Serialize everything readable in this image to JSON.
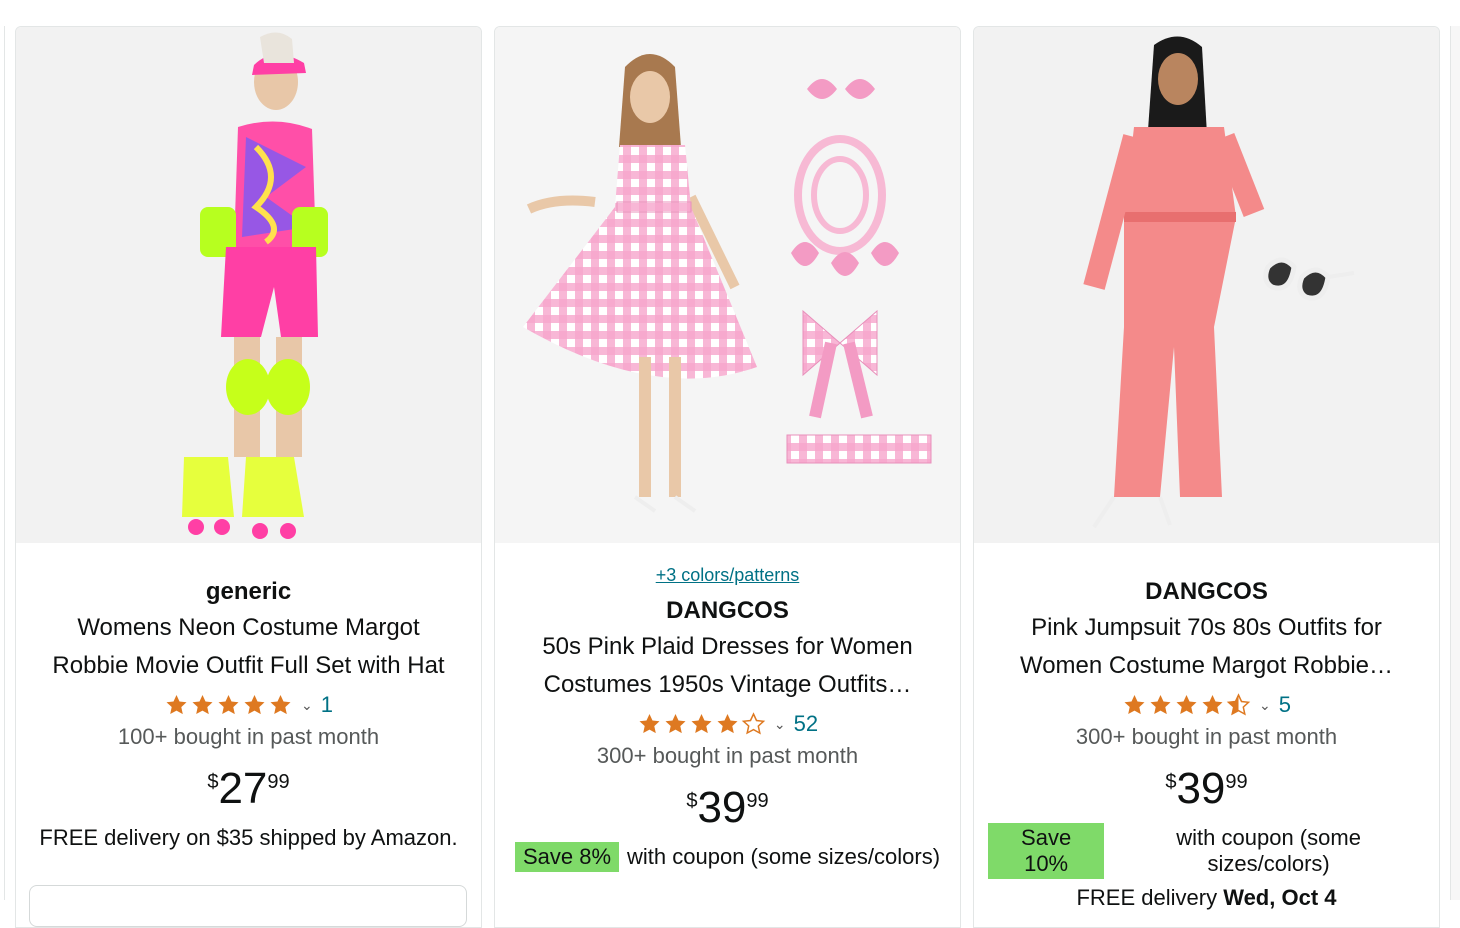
{
  "products": [
    {
      "brand": "generic",
      "title_line1": "Womens Neon Costume Margot",
      "title_line2": "Robbie Movie Outfit Full Set with Hat",
      "rating_value": 5.0,
      "rating_count": "1",
      "bought": "100+ bought in past month",
      "price_symbol": "$",
      "price_whole": "27",
      "price_fraction": "99",
      "delivery_text": "FREE delivery on $35 shipped by Amazon."
    },
    {
      "swatch_link": "+3 colors/patterns",
      "brand": "DANGCOS",
      "title_line1": "50s Pink Plaid Dresses for Women",
      "title_line2": "Costumes 1950s Vintage Outfits…",
      "rating_value": 4.0,
      "rating_count": "52",
      "bought": "300+ bought in past month",
      "price_symbol": "$",
      "price_whole": "39",
      "price_fraction": "99",
      "save_badge": "Save 8%",
      "coupon_text": "with coupon (some sizes/colors)"
    },
    {
      "brand": "DANGCOS",
      "title_line1": "Pink Jumpsuit 70s 80s Outfits for",
      "title_line2": "Women Costume Margot Robbie…",
      "rating_value": 4.5,
      "rating_count": "5",
      "bought": "300+ bought in past month",
      "price_symbol": "$",
      "price_whole": "39",
      "price_fraction": "99",
      "save_badge": "Save 10%",
      "coupon_text": "with coupon (some sizes/colors)",
      "delivery_prefix": "FREE delivery",
      "delivery_date": "Wed, Oct 4"
    }
  ],
  "colors": {
    "link": "#007185",
    "star": "#de7921",
    "coupon_badge": "#7fda69",
    "muted_text": "#565959"
  },
  "icons": [
    "star-icon",
    "half-star-icon",
    "chevron-down-icon"
  ]
}
